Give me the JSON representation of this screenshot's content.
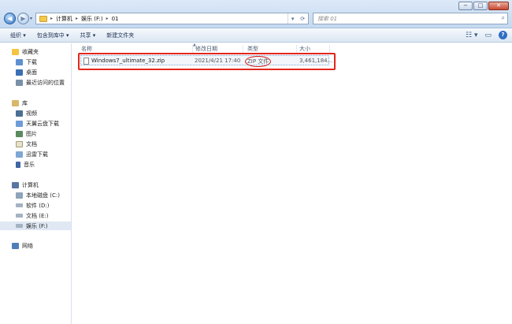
{
  "address": {
    "crumbs": [
      "计算机",
      "娱乐 (F:)",
      "01"
    ]
  },
  "search": {
    "placeholder": "搜索 01"
  },
  "toolbar": {
    "organize": "组织 ▾",
    "include": "包含到库中 ▾",
    "share": "共享 ▾",
    "new_folder": "新建文件夹"
  },
  "sidebar": {
    "favorites": {
      "label": "收藏夹",
      "items": [
        "下载",
        "桌面",
        "最近访问的位置"
      ]
    },
    "libraries": {
      "label": "库",
      "items": [
        "视频",
        "天翼云盘下载",
        "图片",
        "文档",
        "迅雷下载",
        "音乐"
      ]
    },
    "computer": {
      "label": "计算机",
      "items": [
        "本地磁盘 (C:)",
        "软件 (D:)",
        "文档 (E:)",
        "娱乐 (F:)"
      ]
    },
    "network": {
      "label": "网络"
    }
  },
  "columns": [
    "名称",
    "修改日期",
    "类型",
    "大小"
  ],
  "files": [
    {
      "name": "Windows7_ultimate_32.zip",
      "modified": "2021/4/21 17:40",
      "type": "ZIP 文件",
      "size": "3,461,184..."
    }
  ],
  "colors": {
    "accent": "#2f6fc4",
    "annotation": "#e3261c"
  }
}
